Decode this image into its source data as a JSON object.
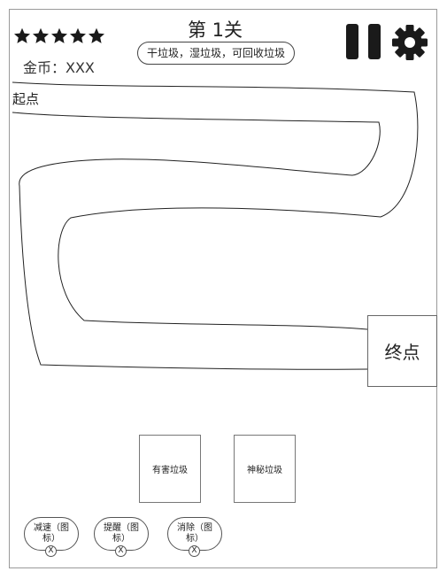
{
  "hud": {
    "rating_stars": 5,
    "coins_label": "金币：XXX",
    "level_title": "第 1关",
    "level_categories": "干垃圾，湿垃圾，可回收垃圾",
    "pause_icon": "pause-icon",
    "settings_icon": "gear-icon"
  },
  "map": {
    "start_label": "起点",
    "end_label": "终点"
  },
  "trash_cards": [
    {
      "label": "有害垃圾"
    },
    {
      "label": "神秘垃圾"
    }
  ],
  "tools": [
    {
      "label": "减速（图标）",
      "count_label": "X"
    },
    {
      "label": "提醒（图标）",
      "count_label": "X"
    },
    {
      "label": "消除（图标）",
      "count_label": "X"
    }
  ],
  "colors": {
    "icon_fill": "#1a1a1a",
    "outline": "#555555",
    "background": "#ffffff"
  }
}
